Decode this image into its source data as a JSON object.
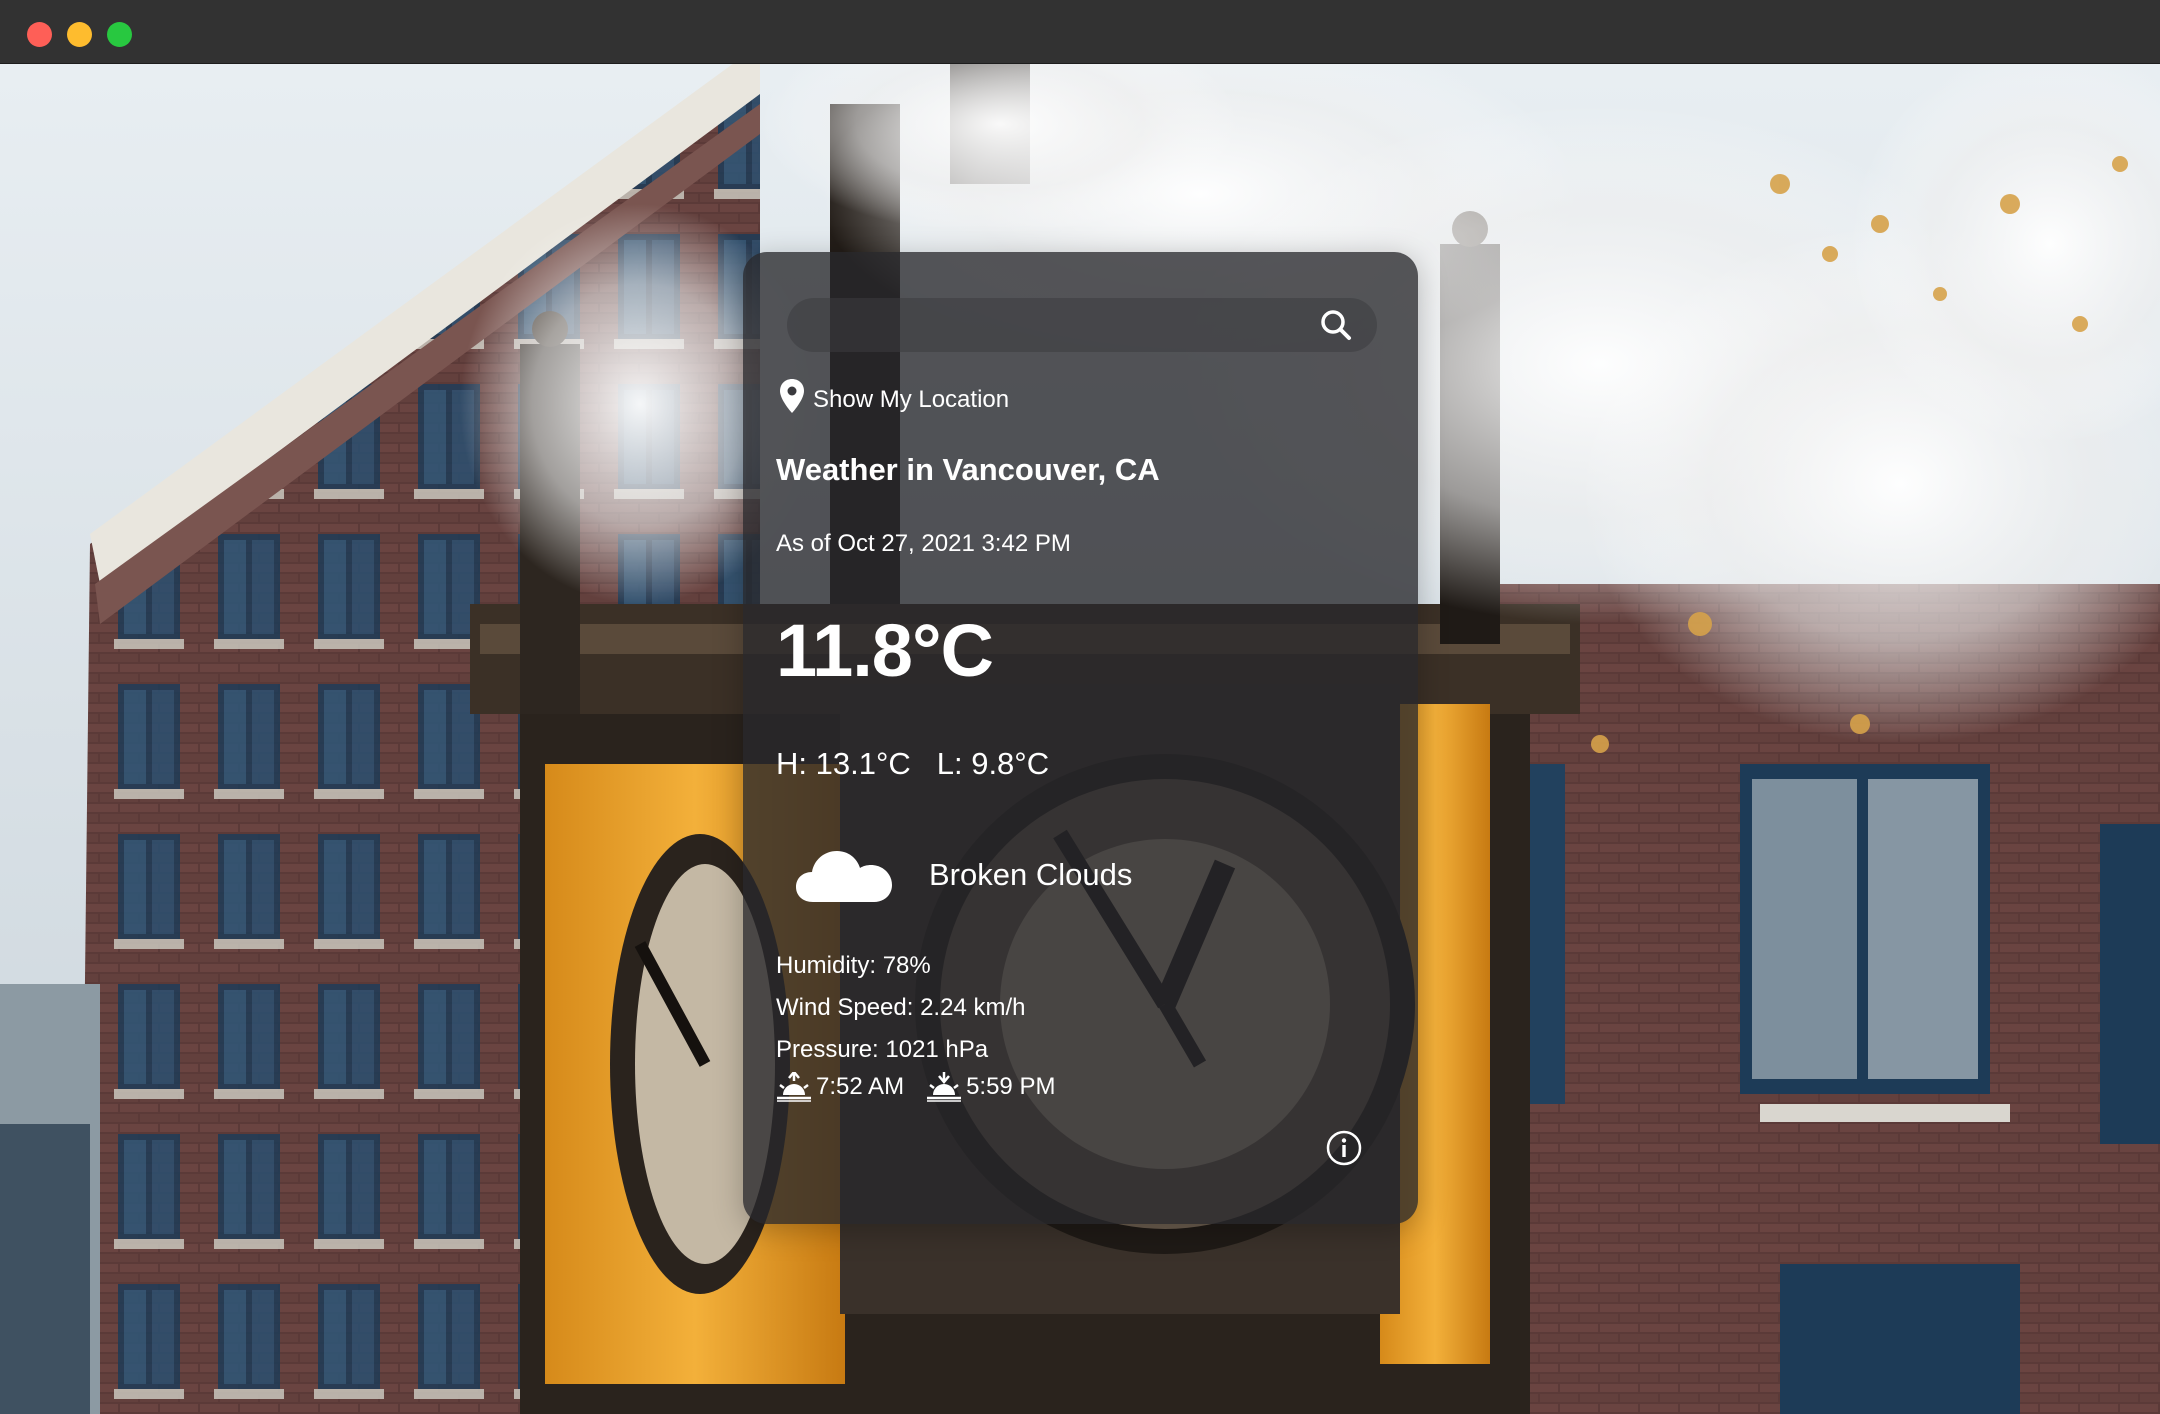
{
  "window": {
    "controls": [
      "close",
      "minimize",
      "maximize"
    ]
  },
  "background": {
    "subject": "gastown-steam-clock-photo"
  },
  "search": {
    "value": "",
    "placeholder": "",
    "icon": "search-icon"
  },
  "location": {
    "label": "Show My Location",
    "icon": "map-pin-icon"
  },
  "weather": {
    "title": "Weather in Vancouver, CA",
    "as_of": "As of Oct 27, 2021 3:42 PM",
    "temperature": "11.8°C",
    "high": "H: 13.1°C",
    "low": "L: 9.8°C",
    "condition": "Broken Clouds",
    "condition_icon": "cloud-icon",
    "humidity": "Humidity: 78%",
    "wind": "Wind Speed: 2.24 km/h",
    "pressure": "Pressure: 1021 hPa",
    "sunrise": "7:52 AM",
    "sunrise_icon": "sunrise-icon",
    "sunset": "5:59 PM",
    "sunset_icon": "sunset-icon"
  },
  "info": {
    "icon": "info-icon"
  },
  "colors": {
    "card_bg": "#28282c",
    "text": "#ffffff",
    "titlebar": "#323232",
    "close": "#fe5f57",
    "minimize": "#febc2e",
    "maximize": "#28c840"
  }
}
